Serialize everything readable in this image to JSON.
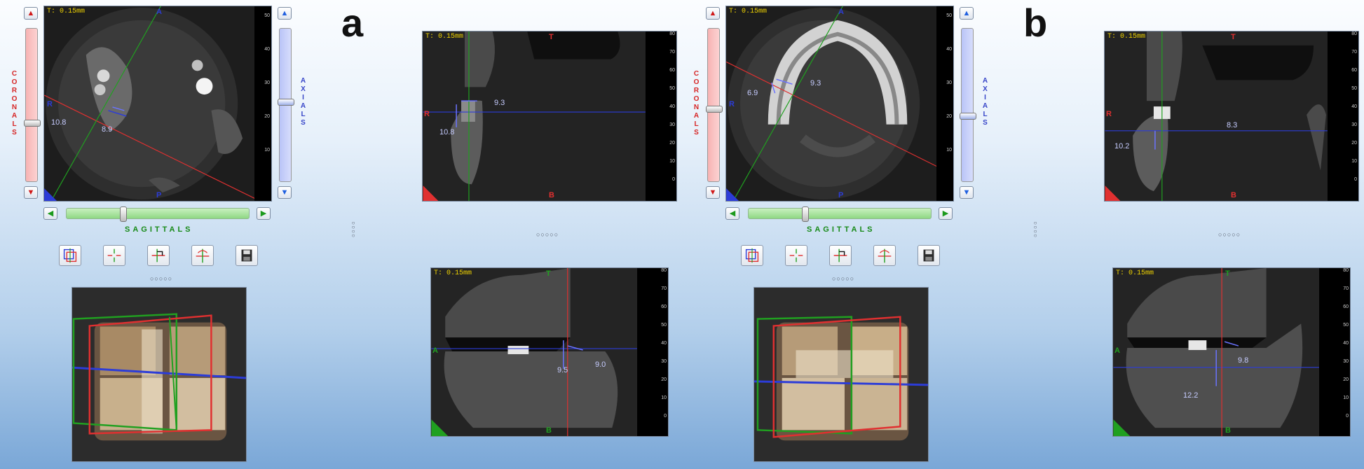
{
  "panels": [
    {
      "label": "a",
      "axial": {
        "thickness": "T: 0.15mm",
        "orient_top": "A",
        "orient_bottom": "P",
        "orient_left": "R",
        "meas1": "10.8",
        "meas2": "8.9"
      },
      "coronal_slider_label": "CORONALS",
      "axial_slider_label": "AXIALS",
      "sagittal_slider_label": "SAGITTALS",
      "coronal_view": {
        "thickness": "T: 0.15mm",
        "orient_top": "T",
        "orient_bottom": "B",
        "orient_left": "R",
        "meas1": "9.3",
        "meas2": "10.8"
      },
      "sagittal_view": {
        "thickness": "T: 0.15mm",
        "orient_top": "T",
        "orient_bottom": "B",
        "orient_left": "A",
        "meas1": "9.5",
        "meas2": "9.0"
      }
    },
    {
      "label": "b",
      "axial": {
        "thickness": "T: 0.15mm",
        "orient_top": "A",
        "orient_bottom": "P",
        "orient_left": "R",
        "meas1": "6.9",
        "meas2": "9.3"
      },
      "coronal_slider_label": "CORONALS",
      "axial_slider_label": "AXIALS",
      "sagittal_slider_label": "SAGITTALS",
      "coronal_view": {
        "thickness": "T: 0.15mm",
        "orient_top": "T",
        "orient_bottom": "B",
        "orient_left": "R",
        "meas1": "8.3",
        "meas2": "10.2"
      },
      "sagittal_view": {
        "thickness": "T: 0.15mm",
        "orient_top": "T",
        "orient_bottom": "B",
        "orient_left": "A",
        "meas1": "9.8",
        "meas2": "12.2"
      }
    }
  ],
  "ruler_ticks": [
    "80",
    "70",
    "60",
    "50",
    "40",
    "30",
    "20",
    "10",
    "0"
  ],
  "axial_ruler_ticks": [
    "50",
    "40",
    "30",
    "20",
    "10"
  ],
  "dots_h": "○○○○○",
  "tools": [
    "mpr-layout-icon",
    "crosshair-icon",
    "angle-crosshair-icon",
    "rotate-crosshair-icon",
    "save-icon"
  ],
  "colors": {
    "coronal": "#e03030",
    "sagittal": "#20a020",
    "axial": "#2c3cd8",
    "thickness_text": "#f1d400"
  }
}
